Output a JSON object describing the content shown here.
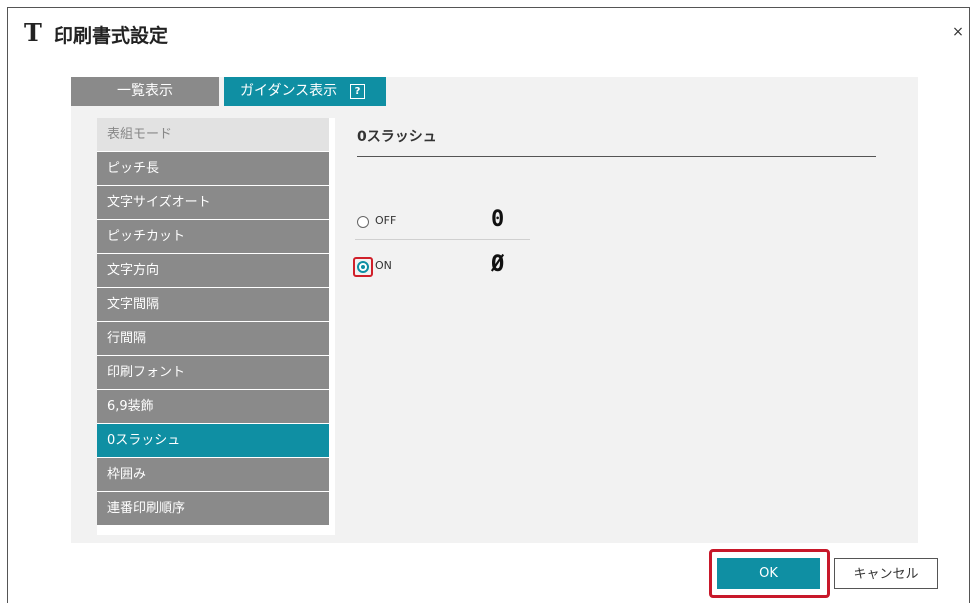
{
  "window": {
    "icon_glyph": "T",
    "title": "印刷書式設定",
    "close_glyph": "×"
  },
  "tabs": [
    {
      "label": "一覧表示",
      "active": false
    },
    {
      "label": "ガイダンス表示",
      "active": true,
      "help_glyph": "?"
    }
  ],
  "menu": {
    "header": "表組モード",
    "items": [
      {
        "label": "ピッチ長",
        "active": false
      },
      {
        "label": "文字サイズオート",
        "active": false
      },
      {
        "label": "ピッチカット",
        "active": false
      },
      {
        "label": "文字方向",
        "active": false
      },
      {
        "label": "文字間隔",
        "active": false
      },
      {
        "label": "行間隔",
        "active": false
      },
      {
        "label": "印刷フォント",
        "active": false
      },
      {
        "label": "6,9装飾",
        "active": false
      },
      {
        "label": "0スラッシュ",
        "active": true
      },
      {
        "label": "枠囲み",
        "active": false
      },
      {
        "label": "連番印刷順序",
        "active": false
      }
    ]
  },
  "pane": {
    "title": "0スラッシュ",
    "options": [
      {
        "label": "OFF",
        "preview": "0",
        "selected": false
      },
      {
        "label": "ON",
        "preview": "Ø",
        "selected": true
      }
    ]
  },
  "buttons": {
    "ok": "OK",
    "cancel": "キャンセル"
  },
  "colors": {
    "accent": "#0f8fa3",
    "menu_gray": "#8a8a8a",
    "highlight_red": "#c8182a"
  }
}
